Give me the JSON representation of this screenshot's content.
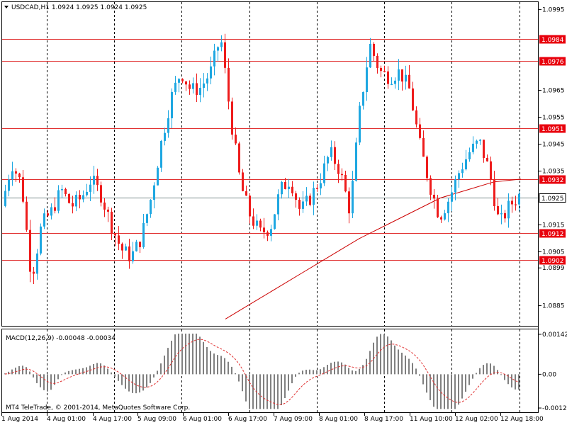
{
  "header": {
    "symbol": "USDCAD,H1",
    "ohlc": "1.0924 1.0925 1.0924 1.0925",
    "text": "USDCAD,H1  1.0924 1.0925 1.0924 1.0925"
  },
  "price_axis": {
    "ticks": [
      "1.0995",
      "1.0965",
      "1.0955",
      "1.0945",
      "1.0935",
      "1.0915",
      "1.0905",
      "1.0899",
      "1.0885"
    ],
    "current_price": "1.0925",
    "level_labels": [
      "1.0984",
      "1.0976",
      "1.0951",
      "1.0932",
      "1.0912",
      "1.0902"
    ]
  },
  "time_axis": {
    "labels": [
      "1 Aug 2014",
      "4 Aug 01:00",
      "4 Aug 17:00",
      "5 Aug 09:00",
      "6 Aug 01:00",
      "6 Aug 17:00",
      "7 Aug 09:00",
      "8 Aug 01:00",
      "8 Aug 17:00",
      "11 Aug 10:00",
      "12 Aug 02:00",
      "12 Aug 18:00"
    ]
  },
  "macd": {
    "label": "MACD(12,26,9) -0.00048 -0.00034",
    "ticks": [
      "0.00142",
      "0.00",
      "-0.0012"
    ]
  },
  "copyright": "MT4 TeleTrade, © 2001-2014, MetaQuotes Software Corp.",
  "colors": {
    "bull": "#1ea7e1",
    "bear": "#ee1c1c",
    "level": "#e03030",
    "ma": "#cc0000",
    "macd_hist": "#808080",
    "signal": "#e03030",
    "price_badge_bg": "#ffffff",
    "level_badge_bg": "#e8000c"
  },
  "chart_data": {
    "type": "candlestick",
    "symbol": "USDCAD",
    "timeframe": "H1",
    "y_range": [
      1.0878,
      1.0997
    ],
    "horizontal_levels": [
      1.0984,
      1.0976,
      1.0951,
      1.0932,
      1.0912,
      1.0902
    ],
    "current_price": 1.0925,
    "price_path": [
      1.0922,
      1.0938,
      1.093,
      1.0895,
      1.0915,
      1.092,
      1.0928,
      1.0922,
      1.0925,
      1.0932,
      1.0926,
      1.0915,
      1.0906,
      1.0903,
      1.091,
      1.0925,
      1.0945,
      1.0962,
      1.0972,
      1.0965,
      1.0966,
      1.0972,
      1.0985,
      1.0955,
      1.093,
      1.0918,
      1.0912,
      1.0914,
      1.0928,
      1.0932,
      1.092,
      1.0925,
      1.0932,
      1.0942,
      1.0935,
      1.092,
      1.0958,
      1.0982,
      1.0972,
      1.097,
      1.0972,
      1.0965,
      1.0945,
      1.093,
      1.0918,
      1.0925,
      1.0935,
      1.0942,
      1.0946,
      1.0935,
      1.0915,
      1.0922,
      1.0926
    ],
    "ma_path": [
      1.088,
      1.0886,
      1.0892,
      1.0898,
      1.0904,
      1.091,
      1.0915,
      1.092,
      1.0925,
      1.0928,
      1.0931,
      1.0932
    ],
    "macd": {
      "value": -0.00048,
      "signal": -0.00034,
      "y_range": [
        -0.0013,
        0.00152
      ]
    }
  }
}
